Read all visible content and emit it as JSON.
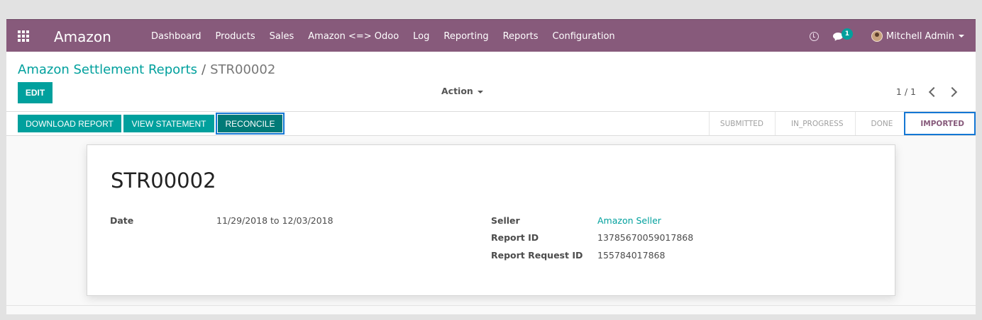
{
  "navbar": {
    "brand": "Amazon",
    "menu": [
      "Dashboard",
      "Products",
      "Sales",
      "Amazon <=> Odoo",
      "Log",
      "Reporting",
      "Reports",
      "Configuration"
    ],
    "chat_count": "1",
    "user_name": "Mitchell Admin",
    "icons": [
      "apps-icon",
      "clock-icon",
      "chat-icon",
      "avatar"
    ]
  },
  "breadcrumb": {
    "parent": "Amazon Settlement Reports",
    "separator": "/",
    "current": "STR00002"
  },
  "control": {
    "edit_label": "EDIT",
    "action_label": "Action",
    "pager_value": "1 / 1"
  },
  "statusbar": {
    "buttons": [
      "DOWNLOAD REPORT",
      "VIEW STATEMENT",
      "RECONCILE"
    ],
    "stages": [
      "SUBMITTED",
      "IN_PROGRESS",
      "DONE",
      "IMPORTED"
    ],
    "active_stage": "IMPORTED"
  },
  "record": {
    "name": "STR00002",
    "left": [
      {
        "label": "Date",
        "value": "11/29/2018 to 12/03/2018"
      }
    ],
    "right": [
      {
        "label": "Seller",
        "value": "Amazon Seller"
      },
      {
        "label": "Report ID",
        "value": "13785670059017868"
      },
      {
        "label": "Report Request ID",
        "value": "155784017868"
      }
    ]
  },
  "colors": {
    "navbar": "#875a7b",
    "primary": "#00a09d",
    "focus_outline": "#1477d4"
  }
}
